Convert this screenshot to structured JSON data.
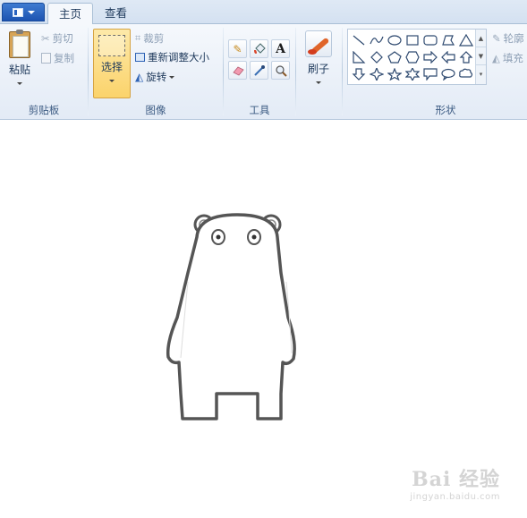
{
  "tabs": [
    {
      "label": "主页",
      "active": true
    },
    {
      "label": "查看",
      "active": false
    }
  ],
  "clipboard": {
    "group_label": "剪贴板",
    "paste_label": "粘贴",
    "cut_label": "剪切",
    "copy_label": "复制"
  },
  "image": {
    "group_label": "图像",
    "select_label": "选择",
    "crop_label": "裁剪",
    "resize_label": "重新调整大小",
    "rotate_label": "旋转"
  },
  "tools": {
    "group_label": "工具",
    "items": [
      "pencil-icon",
      "fill-bucket-icon",
      "text-icon",
      "eraser-icon",
      "color-picker-icon",
      "magnifier-icon"
    ]
  },
  "brush": {
    "label": "刷子"
  },
  "shapes": {
    "group_label": "形状",
    "outline_label": "轮廓",
    "fill_label": "填充"
  },
  "watermark": {
    "brand": "Bai 经验",
    "url": "jingyan.baidu.com"
  },
  "colors": {
    "accent": "#1d54b1",
    "ribbon_bg": "#eef3fa",
    "selected_btn": "#fbd36b",
    "outline": "#555555"
  }
}
